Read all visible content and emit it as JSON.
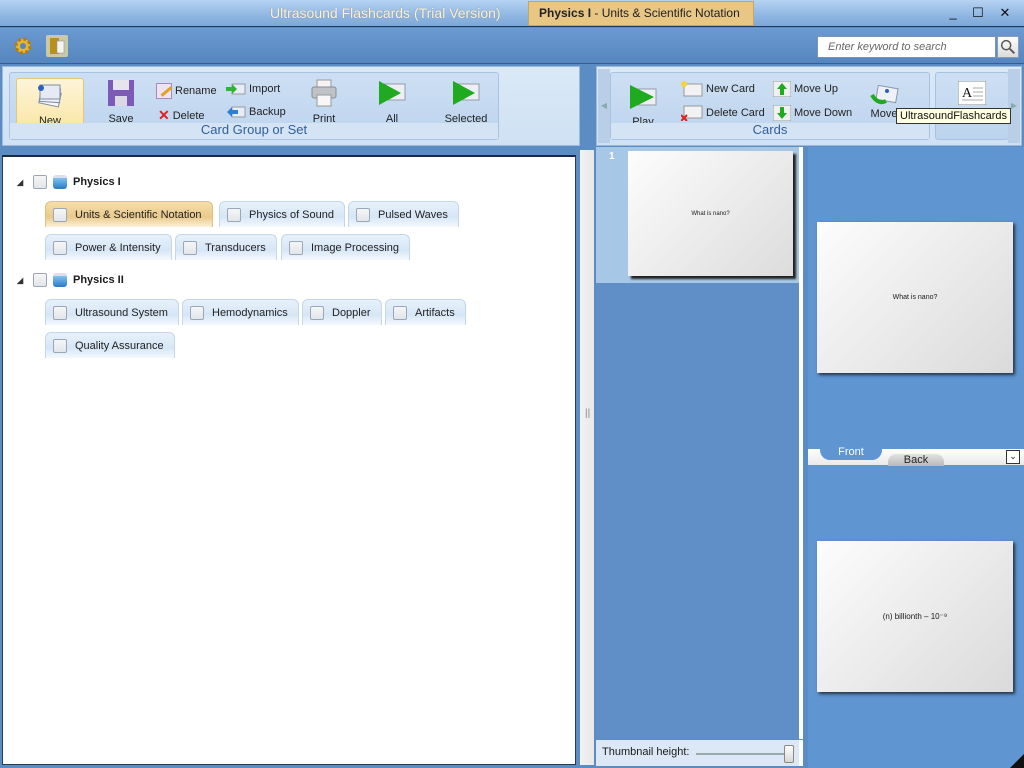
{
  "window": {
    "app_title": "Ultrasound Flashcards (Trial Version)",
    "doc_tab_bold": "Physics I",
    "doc_tab_rest": " - Units & Scientific Notation",
    "minimize": "_",
    "maximize": "☐",
    "close": "✕"
  },
  "quickbar": {
    "settings_icon": "gear-icon",
    "open_icon": "open-book-icon",
    "search_placeholder": "Enter keyword to search"
  },
  "ribbon_left": {
    "group_label": "Card Group or Set",
    "new": "New",
    "save": "Save",
    "rename": "Rename",
    "delete": "Delete",
    "import": "Import",
    "backup": "Backup",
    "print": "Print",
    "all": "All",
    "selected": "Selected"
  },
  "ribbon_right": {
    "group_label": "Cards",
    "play": "Play",
    "new_card": "New Card",
    "delete_card": "Delete Card",
    "move_up": "Move Up",
    "move_down": "Move Down",
    "move": "Move",
    "tooltip": "UltrasoundFlashcards"
  },
  "tree": {
    "groups": [
      {
        "name": "Physics I",
        "sets": [
          "Units & Scientific Notation",
          "Physics of Sound",
          "Pulsed Waves",
          "Power & Intensity",
          "Transducers",
          "Image Processing"
        ],
        "selected_set": "Units & Scientific Notation"
      },
      {
        "name": "Physics II",
        "sets": [
          "Ultrasound System",
          "Hemodynamics",
          "Doppler",
          "Artifacts",
          "Quality Assurance"
        ]
      }
    ]
  },
  "thumbnails": {
    "items": [
      {
        "number": "1",
        "text": "What is nano?"
      }
    ],
    "footer_label": "Thumbnail height:",
    "slider_value_fraction": 1.0
  },
  "preview": {
    "front_text": "What is nano?",
    "back_text": "(n) billionth – 10⁻⁹",
    "tab_front": "Front",
    "tab_back": "Back",
    "active_tab": "Front"
  }
}
